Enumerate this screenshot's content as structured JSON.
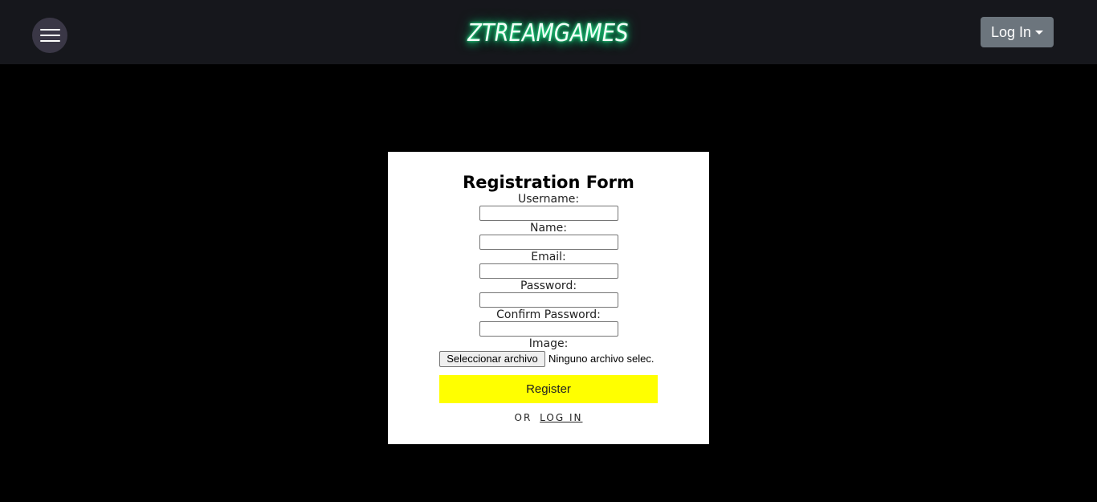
{
  "header": {
    "menu_icon": "hamburger-menu-icon",
    "brand": "ZTREAMGAMES",
    "brand_glow_color": "#2dff9b",
    "login_button_label": "Log In",
    "login_caret_icon": "caret-down-icon"
  },
  "form": {
    "title": "Registration Form",
    "fields": {
      "username_label": "Username:",
      "name_label": "Name:",
      "email_label": "Email:",
      "password_label": "Password:",
      "confirm_password_label": "Confirm Password:",
      "image_label": "Image:"
    },
    "file_button_label": "Seleccionar archivo",
    "file_status": "Ninguno archivo selec.",
    "register_button_label": "Register",
    "register_button_color": "#ffff00",
    "or_text": "OR",
    "login_link_text": "LOG IN"
  }
}
